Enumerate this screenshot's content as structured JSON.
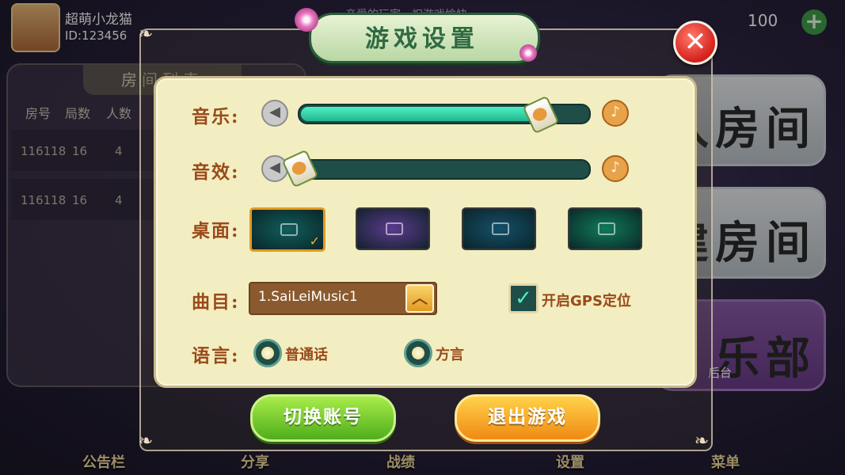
{
  "player": {
    "name": "超萌小龙猫",
    "id": "ID:123456",
    "coins": "100",
    "add_label": "+"
  },
  "notice": "亲爱的玩家，祝游戏愉快",
  "background": {
    "room_list_tab": "房间列表",
    "columns": [
      "房号",
      "局数",
      "人数"
    ],
    "rows": [
      {
        "room": "116118",
        "rounds": "16",
        "players": "4"
      },
      {
        "room": "116118",
        "rounds": "16",
        "players": "4"
      }
    ],
    "right_buttons": [
      "入房间",
      "建房间",
      "乐部"
    ],
    "backstage_label": "后台",
    "bottom_nav": [
      "公告栏",
      "分享",
      "战绩",
      "设置",
      "菜单"
    ]
  },
  "dialog": {
    "title": "游戏设置",
    "close_icon": "close-icon",
    "music_label": "音乐:",
    "music_volume": 0.83,
    "sound_label": "音效:",
    "sound_volume": 0.0,
    "table_label": "桌面:",
    "table_themes": [
      {
        "name": "teal",
        "color": "#0f5e5c",
        "selected": true
      },
      {
        "name": "purple",
        "color": "#5b3a8e",
        "selected": false
      },
      {
        "name": "blue",
        "color": "#13506a",
        "selected": false
      },
      {
        "name": "green",
        "color": "#0f7a5a",
        "selected": false
      }
    ],
    "track_label": "曲目:",
    "track_value": "1.SaiLeiMusic1",
    "gps_label": "开启GPS定位",
    "gps_enabled": true,
    "language_label": "语言:",
    "language_options": [
      "普通话",
      "方言"
    ],
    "switch_account": "切换账号",
    "exit_game": "退出游戏",
    "check_symbol": "✓",
    "arrow_symbol": "︿",
    "x_symbol": "✕",
    "note_symbol": "♪"
  }
}
